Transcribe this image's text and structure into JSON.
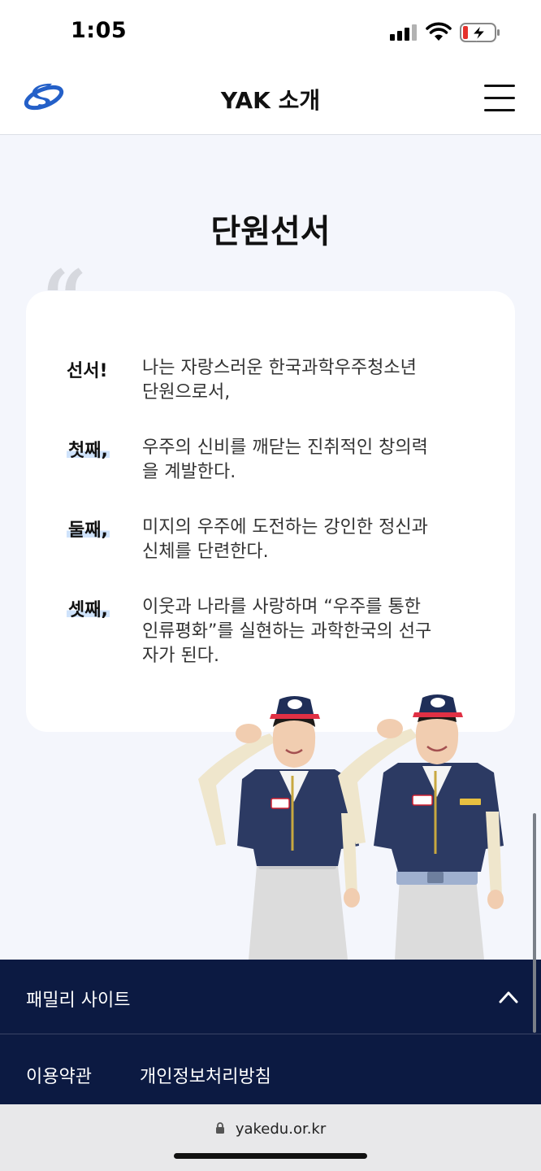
{
  "status_bar": {
    "time": "1:05",
    "icons": [
      "cellular-signal-icon",
      "wifi-icon",
      "battery-charging-icon"
    ]
  },
  "header": {
    "title": "YAK 소개",
    "logo_icon": "yak-logo-icon",
    "menu_icon": "hamburger-menu-icon"
  },
  "main": {
    "title": "단원선서",
    "quote_mark": "“",
    "oath": [
      {
        "label": "선서!",
        "lines": [
          "나는 자랑스러운 한국과학우주청소년",
          "단원으로서,"
        ]
      },
      {
        "label": "첫째,",
        "lines": [
          "우주의 신비를 깨닫는 진취적인 창의력",
          "을 계발한다."
        ]
      },
      {
        "label": "둘째,",
        "lines": [
          "미지의 우주에 도전하는 강인한 정신과",
          "신체를 단련한다."
        ]
      },
      {
        "label": "셋째,",
        "lines": [
          "이웃과 나라를 사랑하며 “우주를 통한",
          "인류평화”를 실현하는 과학한국의 선구",
          "자가 된다."
        ]
      }
    ]
  },
  "footer": {
    "family_site": "패밀리 사이트",
    "toggle_icon": "chevron-up-icon",
    "links": [
      "이용약관",
      "개인정보처리방침"
    ]
  },
  "browser": {
    "url": "yakedu.or.kr",
    "lock_icon": "lock-icon"
  },
  "colors": {
    "background": "#f4f6fc",
    "footer_navy": "#0c1a42",
    "highlight_blue": "#cfe3fb",
    "logo_blue": "#2460c8"
  }
}
